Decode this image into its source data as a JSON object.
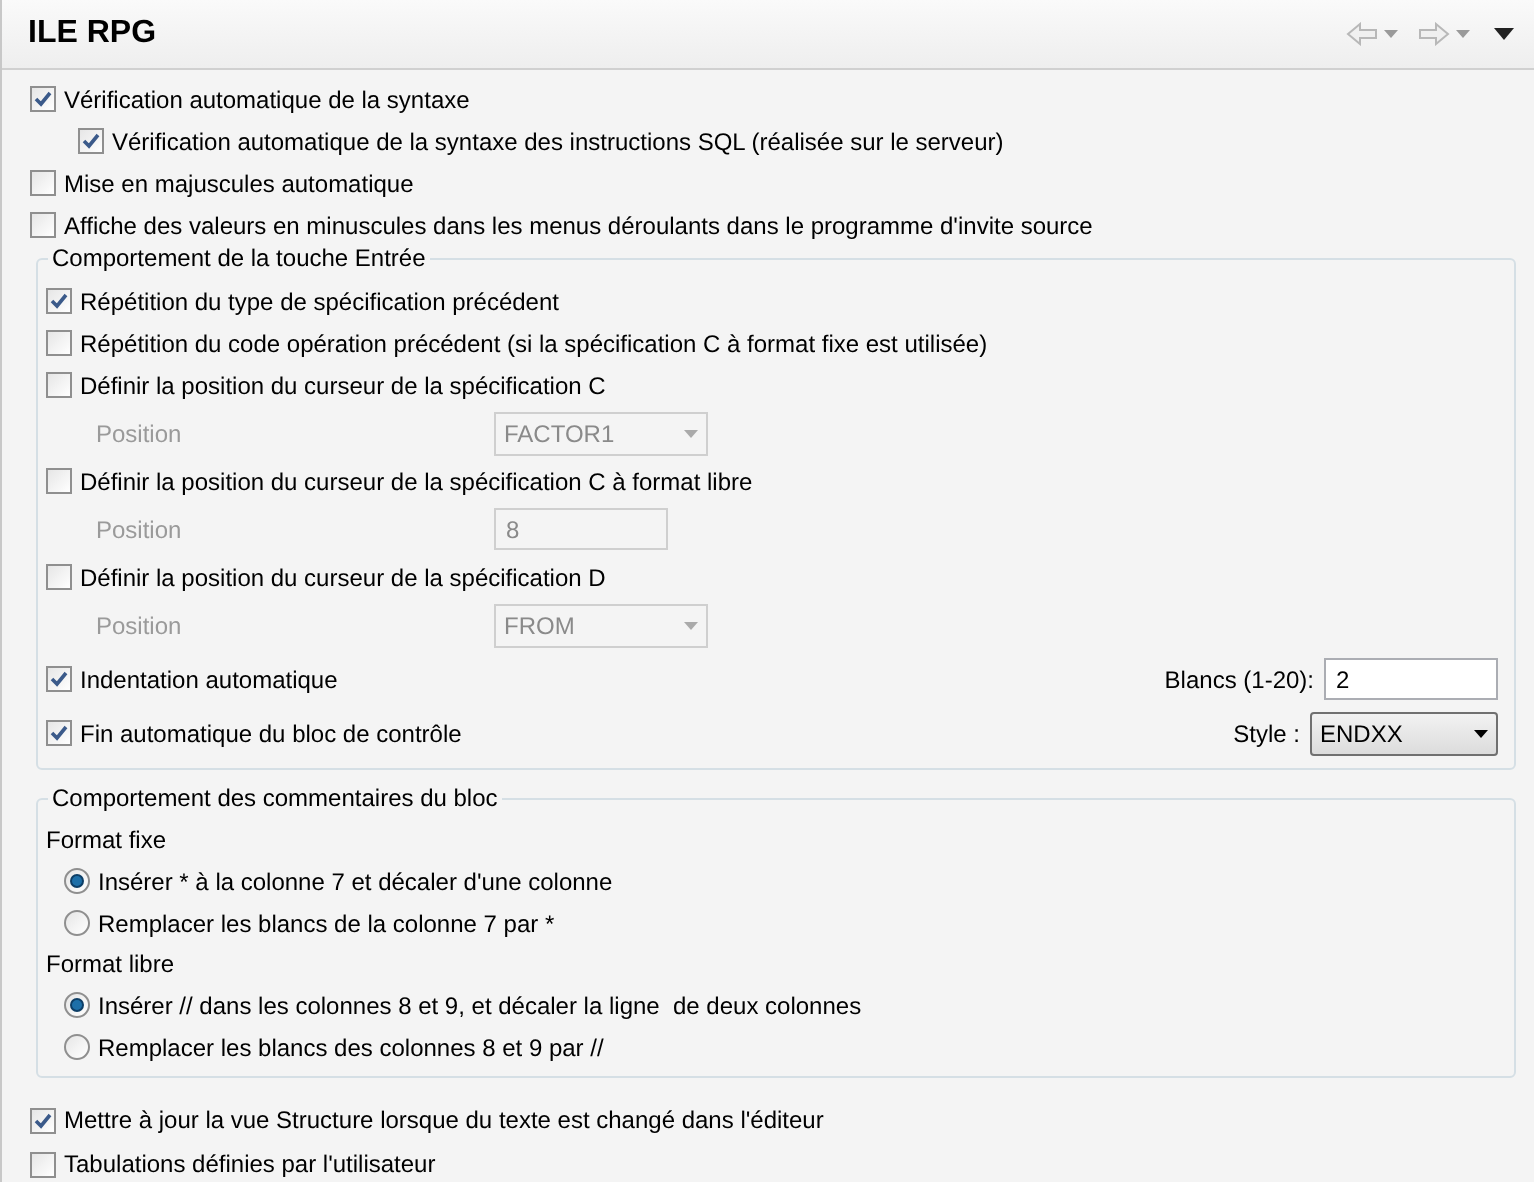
{
  "title": "ILE RPG",
  "nav": {
    "back_disabled": true,
    "forward_disabled": true
  },
  "options": [
    {
      "label": "Vérification automatique de la syntaxe",
      "checked": true,
      "indented": false
    },
    {
      "label": "Vérification automatique de la syntaxe des instructions SQL (réalisée sur le serveur)",
      "checked": true,
      "indented": true
    },
    {
      "label": "Mise en majuscules automatique",
      "checked": false,
      "indented": false
    },
    {
      "label": "Affiche des valeurs en minuscules dans les menus déroulants dans le programme d'invite source",
      "checked": false,
      "indented": false
    }
  ],
  "enter_group": {
    "title": "Comportement de la touche Entrée",
    "items": [
      {
        "label": "Répétition du type de spécification précédent",
        "checked": true
      },
      {
        "label": "Répétition du code opération précédent (si la spécification C à format fixe est utilisée)",
        "checked": false
      },
      {
        "label": "Définir la position du curseur de la spécification C",
        "checked": false,
        "sub": {
          "label": "Position",
          "kind": "combo",
          "value": "FACTOR1",
          "disabled": true
        }
      },
      {
        "label": "Définir la position du curseur de la spécification C à format libre",
        "checked": false,
        "sub": {
          "label": "Position",
          "kind": "text",
          "value": "8",
          "disabled": true
        }
      },
      {
        "label": "Définir la position du curseur de la spécification D",
        "checked": false,
        "sub": {
          "label": "Position",
          "kind": "combo",
          "value": "FROM",
          "disabled": true
        }
      },
      {
        "label": "Indentation automatique",
        "checked": true,
        "side": {
          "label": "Blancs (1-20):",
          "kind": "text",
          "value": "2"
        }
      },
      {
        "label": "Fin automatique du bloc de contrôle",
        "checked": true,
        "side": {
          "label": "Style :",
          "kind": "dropdown",
          "value": "ENDXX"
        }
      }
    ]
  },
  "comment_group": {
    "title": "Comportement des commentaires du bloc",
    "sections": [
      {
        "heading": "Format fixe",
        "choices": [
          {
            "label": "Insérer * à la colonne 7 et décaler d'une colonne",
            "selected": true
          },
          {
            "label": "Remplacer les blancs de la colonne 7 par *",
            "selected": false
          }
        ]
      },
      {
        "heading": "Format libre",
        "choices": [
          {
            "label": "Insérer // dans les colonnes 8 et 9, et décaler la ligne  de deux colonnes",
            "selected": true
          },
          {
            "label": "Remplacer les blancs des colonnes 8 et 9 par //",
            "selected": false
          }
        ]
      }
    ]
  },
  "bottom_options": [
    {
      "label": "Mettre à jour la vue Structure lorsque du texte est changé dans l'éditeur",
      "checked": true
    },
    {
      "label": "Tabulations définies par l'utilisateur",
      "checked": false
    }
  ]
}
